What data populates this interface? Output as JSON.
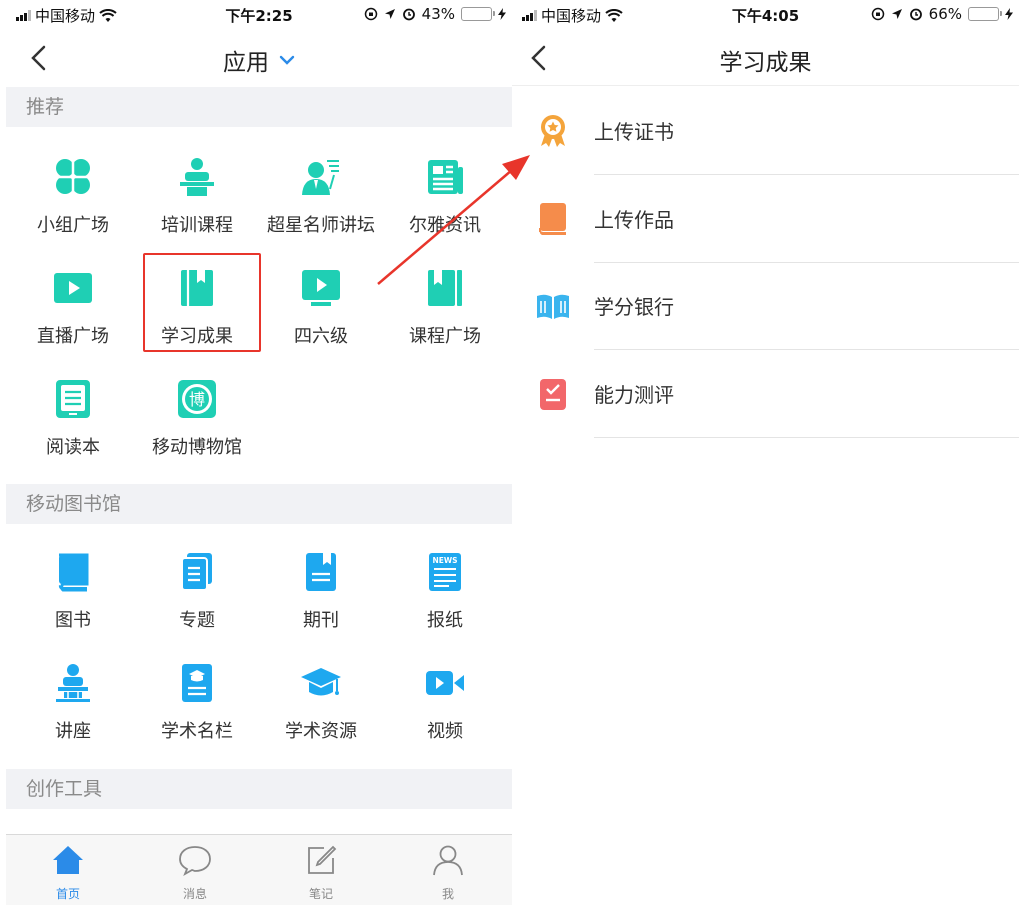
{
  "left": {
    "status": {
      "carrier": "中国移动",
      "time": "下午2:25",
      "battery": "43%",
      "battery_level": 0.43
    },
    "nav": {
      "title": "应用"
    },
    "sections": {
      "recommend": "推荐",
      "library": "移动图书馆",
      "tools": "创作工具"
    },
    "recommend_items": [
      {
        "label": "小组广场",
        "icon": "group-square-icon"
      },
      {
        "label": "培训课程",
        "icon": "training-course-icon"
      },
      {
        "label": "超星名师讲坛",
        "icon": "lecture-forum-icon"
      },
      {
        "label": "尔雅资讯",
        "icon": "news-icon"
      },
      {
        "label": "直播广场",
        "icon": "live-square-icon"
      },
      {
        "label": "学习成果",
        "icon": "learning-results-icon"
      },
      {
        "label": "四六级",
        "icon": "cet-icon"
      },
      {
        "label": "课程广场",
        "icon": "course-square-icon"
      },
      {
        "label": "阅读本",
        "icon": "reading-book-icon"
      },
      {
        "label": "移动博物馆",
        "icon": "museum-icon"
      }
    ],
    "library_items": [
      {
        "label": "图书",
        "icon": "book-icon"
      },
      {
        "label": "专题",
        "icon": "topic-icon"
      },
      {
        "label": "期刊",
        "icon": "journal-icon"
      },
      {
        "label": "报纸",
        "icon": "newspaper-icon"
      },
      {
        "label": "讲座",
        "icon": "lecture-icon"
      },
      {
        "label": "学术名栏",
        "icon": "academic-column-icon"
      },
      {
        "label": "学术资源",
        "icon": "academic-resource-icon"
      },
      {
        "label": "视频",
        "icon": "video-icon"
      }
    ],
    "newspaper_icon_text": "NEWS",
    "museum_icon_text": "博",
    "tabs": [
      {
        "label": "首页",
        "icon": "home-icon",
        "active": true
      },
      {
        "label": "消息",
        "icon": "message-icon",
        "active": false
      },
      {
        "label": "笔记",
        "icon": "note-icon",
        "active": false
      },
      {
        "label": "我",
        "icon": "profile-icon",
        "active": false
      }
    ]
  },
  "right": {
    "status": {
      "carrier": "中国移动",
      "time": "下午4:05",
      "battery": "66%",
      "battery_level": 0.66
    },
    "nav": {
      "title": "学习成果"
    },
    "items": [
      {
        "label": "上传证书",
        "icon": "certificate-icon"
      },
      {
        "label": "上传作品",
        "icon": "works-icon"
      },
      {
        "label": "学分银行",
        "icon": "credit-bank-icon"
      },
      {
        "label": "能力测评",
        "icon": "ability-test-icon"
      }
    ]
  },
  "colors": {
    "teal": "#1fcfb4",
    "blue": "#1ea8ef",
    "tab_active": "#2b8be8",
    "highlight": "#e8352b",
    "section_bg": "#f1f2f5"
  }
}
